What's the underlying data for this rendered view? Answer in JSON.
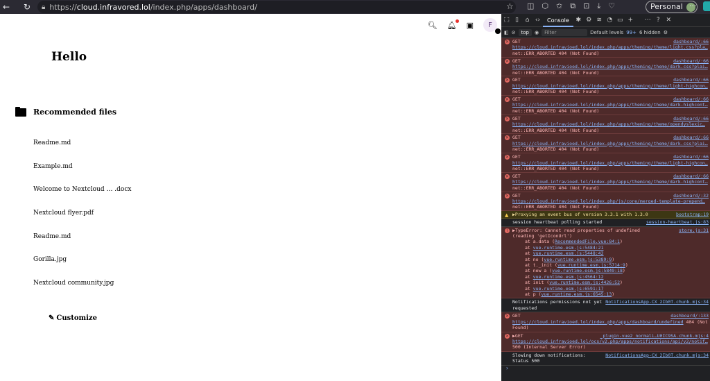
{
  "browser": {
    "url_prefix": "https://",
    "url_host": "cloud.infravored.lol",
    "url_path": "/index.php/apps/dashboard/",
    "profile_label": "Personal"
  },
  "page": {
    "greeting": "Hello",
    "section_title": "Recommended files",
    "files": [
      "Readme.md",
      "Example.md",
      "Welcome to Nextcloud … .docx",
      "Nextcloud flyer.pdf",
      "Readme.md",
      "Gorilla.jpg",
      "Nextcloud community.jpg"
    ],
    "customize_label": "Customize",
    "avatar_initial": "F"
  },
  "devtools": {
    "console_tab": "Console",
    "context": "top",
    "filter_placeholder": "Filter",
    "levels": "Default levels",
    "issues_count": "99+",
    "hidden": "6 hidden",
    "errors": [
      {
        "method": "GET",
        "src": "dashboard/:66",
        "url": "https://cloud.infravioed.lol/index.php/apps/theming/theme/light.css?pla…",
        "status": "net::ERR_ABORTED 404 (Not Found)"
      },
      {
        "method": "GET",
        "src": "dashboard/:66",
        "url": "https://cloud.infravioed.lol/index.php/apps/theming/theme/dark.css?plai…",
        "status": "net::ERR_ABORTED 404 (Not Found)"
      },
      {
        "method": "GET",
        "src": "dashboard/:66",
        "url": "https://cloud.infravioed.lol/index.php/apps/theming/theme/light-highcon…",
        "status": "net::ERR_ABORTED 404 (Not Found)"
      },
      {
        "method": "GET",
        "src": "dashboard/:66",
        "url": "https://cloud.infravioed.lol/index.php/apps/theming/theme/dark-highcont…",
        "status": "net::ERR_ABORTED 404 (Not Found)"
      },
      {
        "method": "GET",
        "src": "dashboard/:66",
        "url": "https://cloud.infravioed.lol/index.php/apps/theming/theme/opendyslexic…",
        "status": "net::ERR_ABORTED 404 (Not Found)"
      },
      {
        "method": "GET",
        "src": "dashboard/:66",
        "url": "https://cloud.infravioed.lol/index.php/apps/theming/theme/dark.css?plai…",
        "status": "net::ERR_ABORTED 404 (Not Found)"
      },
      {
        "method": "GET",
        "src": "dashboard/:66",
        "url": "https://cloud.infravioed.lol/index.php/apps/theming/theme/light-highcon…",
        "status": "net::ERR_ABORTED 404 (Not Found)"
      },
      {
        "method": "GET",
        "src": "dashboard/:66",
        "url": "https://cloud.infravioed.lol/index.php/apps/theming/theme/dark-highcont…",
        "status": "net::ERR_ABORTED 404 (Not Found)"
      },
      {
        "method": "GET",
        "src": "dashboard/:32",
        "url": "https://cloud.infravioed.lol/index.php/js/core/merged-template-prepend…",
        "status": "net::ERR_ABORTED 404 (Not Found)"
      }
    ],
    "warn": {
      "text": "▶Proxying an event bus of version 3.3.1 with 1.3.0",
      "src": "bootstrap:19"
    },
    "heartbeat": {
      "text": "session heartbeat polling started",
      "src": "session-heartbeat.js:83"
    },
    "type_error": {
      "line1": "▶TypeError: Cannot read properties of undefined",
      "line2": "(reading 'getIconUrl')",
      "src": "store.js:31",
      "stack": [
        {
          "pre": "at a.data (",
          "loc": "RecommendedFile.vue:84:1",
          "post": ")"
        },
        {
          "pre": "at ",
          "loc": "vue.runtime.esm.js:5484:21",
          "post": ""
        },
        {
          "pre": "at ",
          "loc": "vue.runtime.esm.js:5448:42",
          "post": ""
        },
        {
          "pre": "at no (",
          "loc": "vue.runtime.esm.js:5389:9",
          "post": ")"
        },
        {
          "pre": "at t._init (",
          "loc": "vue.runtime.esm.js:5714:9",
          "post": ")"
        },
        {
          "pre": "at new a (",
          "loc": "vue.runtime.esm.js:5849:18",
          "post": ")"
        },
        {
          "pre": "at ",
          "loc": "vue.runtime.esm.js:4564:12",
          "post": ""
        },
        {
          "pre": "at init (",
          "loc": "vue.runtime.esm.js:4426:52",
          "post": ")"
        },
        {
          "pre": "at ",
          "loc": "vue.runtime.esm.js:6591:17",
          "post": ""
        },
        {
          "pre": "at p (",
          "loc": "vue.runtime.esm.js:6545:13",
          "post": ")"
        }
      ]
    },
    "notif": {
      "text": "Notifications permissions not yet",
      "text2": "requested",
      "src": "NotificationsApp-CX_2Ib0T.chunk.mjs:34"
    },
    "err2": {
      "method": "GET",
      "src": "dashboard/:133",
      "url": "https://cloud.infravioed.lol/index.php/apps/dashboard/undefined",
      "status": "404 (Not",
      "status2": "Found)"
    },
    "err3": {
      "method": "▶GET",
      "src": "_plugin-vue2_normali…U0IC9SA.chunk.mjs:4",
      "url": "https://cloud.infravioed.lol/ocs/v2.php/apps/notifications/api/v2/notif…",
      "status": "500 (Internal Server Error)"
    },
    "slow": {
      "text": "Slowing down notifications:",
      "text2": "Status 500",
      "src": "NotificationsApp-CX_2Ib0T.chunk.mjs:34"
    }
  }
}
